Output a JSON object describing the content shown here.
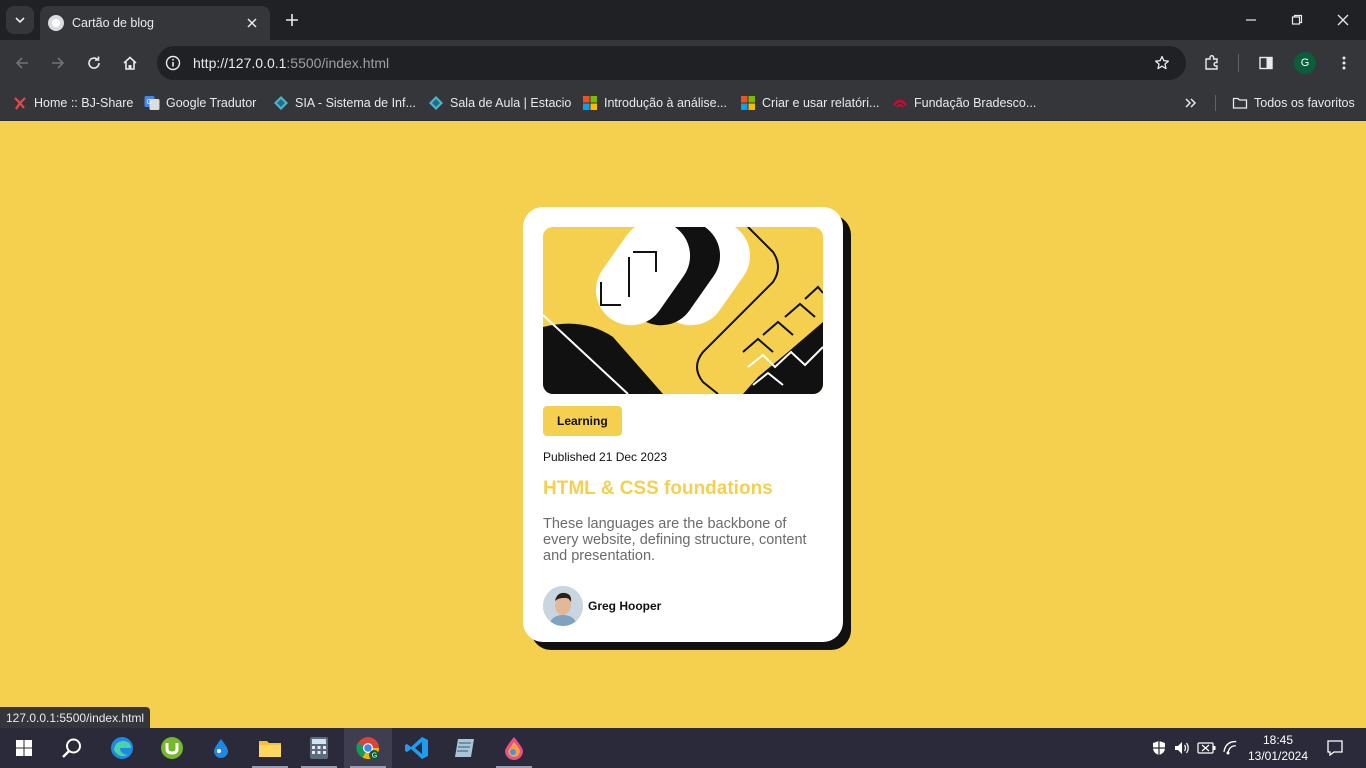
{
  "browser": {
    "tab_title": "Cartão de blog",
    "url_host": "http://127.0.0.1",
    "url_rest": ":5500/index.html",
    "profile_initial": "G",
    "bookmarks": [
      {
        "label": "Home :: BJ-Share",
        "icon": "bjshare-icon"
      },
      {
        "label": "Google Tradutor",
        "icon": "google-translate-icon"
      },
      {
        "label": "SIA - Sistema de Inf...",
        "icon": "diamond-icon"
      },
      {
        "label": "Sala de Aula | Estacio",
        "icon": "diamond-icon"
      },
      {
        "label": "Introdução à análise...",
        "icon": "microsoft-icon"
      },
      {
        "label": "Criar e usar relatóri...",
        "icon": "microsoft-icon"
      },
      {
        "label": "Fundação Bradesco...",
        "icon": "bradesco-icon"
      }
    ],
    "all_bookmarks_label": "Todos os favoritos",
    "status_url": "127.0.0.1:5500/index.html"
  },
  "card": {
    "tag": "Learning",
    "published": "Published 21 Dec 2023",
    "title": "HTML & CSS foundations",
    "description": "These languages are the backbone of every website, defining structure, content and presentation.",
    "author": "Greg Hooper"
  },
  "taskbar": {
    "time": "18:45",
    "date": "13/01/2024",
    "apps": [
      "start",
      "search",
      "edge",
      "utorrent",
      "drop",
      "file-explorer",
      "calculator",
      "chrome",
      "vscode",
      "notepad",
      "paint"
    ]
  },
  "colors": {
    "page_bg": "#f4d04e",
    "card_bg": "#ffffff",
    "shadow": "#111111",
    "title": "#f4d04e",
    "text_muted": "#6b6b6b"
  }
}
